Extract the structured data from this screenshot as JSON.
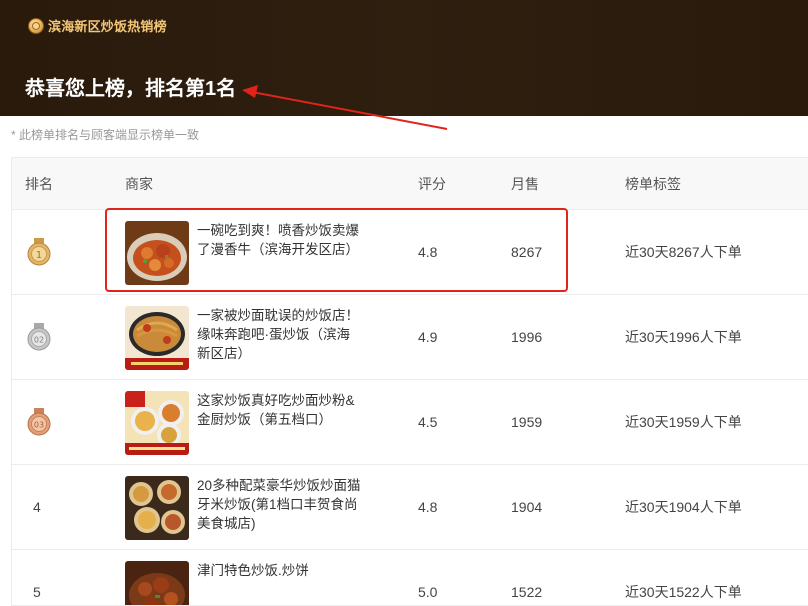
{
  "banner": {
    "subtitle": "滨海新区炒饭热销榜",
    "title": "恭喜您上榜，排名第1名"
  },
  "note": "* 此榜单排名与顾客端显示榜单一致",
  "table": {
    "headers": {
      "rank": "排名",
      "merchant": "商家",
      "score": "评分",
      "sales": "月售",
      "tag": "榜单标签"
    },
    "rows": [
      {
        "rank": "1",
        "medal": "gold",
        "name": "一碗吃到爽！喷香炒饭卖爆了漫香牛（滨海开发区店）",
        "score": "4.8",
        "sales": "8267",
        "tag": "近30天8267人下单",
        "thumb": "fried-rice-dish"
      },
      {
        "rank": "02",
        "medal": "silver",
        "name": "一家被炒面耽误的炒饭店！缘味奔跑吧·蛋炒饭（滨海新区店）",
        "score": "4.9",
        "sales": "1996",
        "tag": "近30天1996人下单",
        "thumb": "fried-noodles-dish"
      },
      {
        "rank": "03",
        "medal": "bronze",
        "name": "这家炒饭真好吃炒面炒粉&金厨炒饭（第五档口）",
        "score": "4.5",
        "sales": "1959",
        "tag": "近30天1959人下单",
        "thumb": "fried-rice-plates"
      },
      {
        "rank": "4",
        "medal": "",
        "name": "20多种配菜豪华炒饭炒面猫牙米炒饭(第1档口丰贺食尚美食城店)",
        "score": "4.8",
        "sales": "1904",
        "tag": "近30天1904人下单",
        "thumb": "assorted-dishes"
      },
      {
        "rank": "5",
        "medal": "",
        "name": "津门特色炒饭.炒饼",
        "score": "5.0",
        "sales": "1522",
        "tag": "近30天1522人下单",
        "thumb": "braised-dish"
      }
    ]
  },
  "colors": {
    "banner_bg": "#2c1c0d",
    "banner_subtitle": "#f3c677",
    "highlight": "#e0241b"
  }
}
